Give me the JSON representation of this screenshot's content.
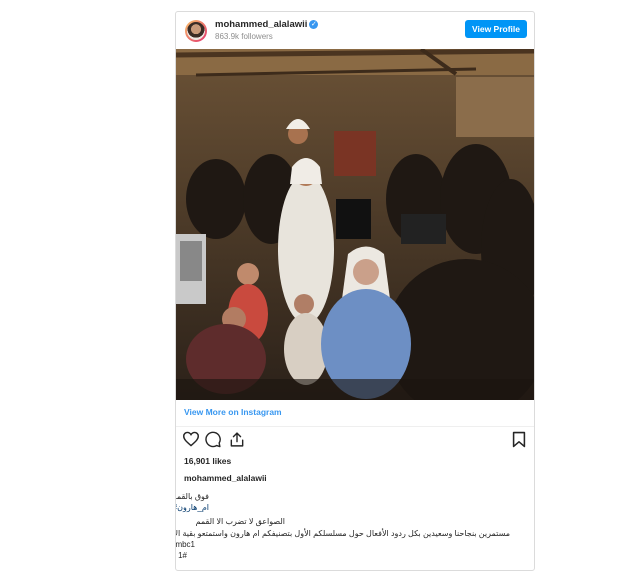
{
  "post": {
    "username": "mohammed_alalawii",
    "followers": "863.9k followers",
    "view_profile_label": "View Profile",
    "view_more_label": "View More on Instagram",
    "likes": "16,901 likes",
    "caption_username": "mohammed_alalawii",
    "caption_lines": [
      "فوق بالقمه",
      "ام_هارون#",
      "الصواعق لا تضرب الا القمم",
      "مستمرين بنجاحنا وسعيدين بكل ردود الأفعال حول مسلسلكم الأول بتصنيفكم ام هارون واستمتعو بقية الاحداث على قناة",
      "mbc1",
      "1#"
    ],
    "heart_icon": "❤"
  },
  "colors": {
    "accent": "#0095f6",
    "link": "#3897f0",
    "heart": "#ed4956"
  }
}
